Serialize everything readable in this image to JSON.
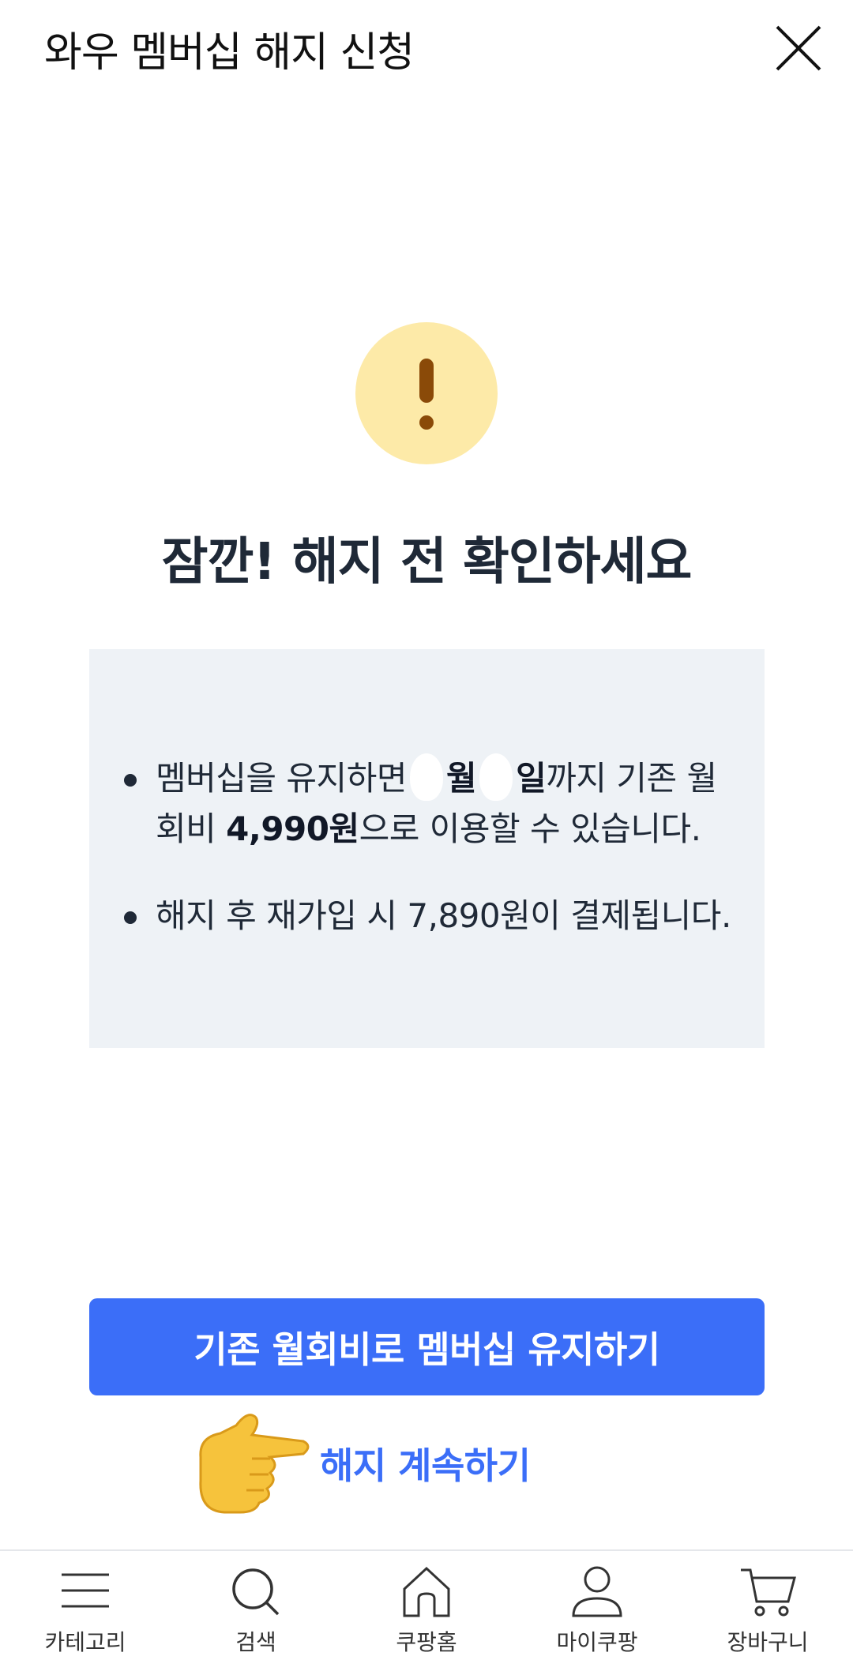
{
  "header": {
    "title": "와우 멤버십 해지 신청"
  },
  "alert": {
    "icon": "exclamation-icon",
    "circle_color": "#fdeaa8",
    "mark_color": "#8a4a08"
  },
  "heading": "잠깐! 해지 전 확인하세요",
  "info": {
    "item1": {
      "part1": "멤버십을 유지하면",
      "month_unit": "월",
      "day_unit": "일",
      "part2": "까지 기존 월회비",
      "price": "4,990원",
      "part3": "으로 이용할 수 있습니다."
    },
    "item2": {
      "text": "해지 후 재가입 시 7,890원이 결제됩니다."
    }
  },
  "actions": {
    "keep_label": "기존 월회비로 멤버십 유지하기",
    "cancel_label": "해지 계속하기",
    "accent_color": "#3b6ef8"
  },
  "nav": {
    "items": [
      {
        "label": "카테고리",
        "icon": "menu-icon"
      },
      {
        "label": "검색",
        "icon": "search-icon"
      },
      {
        "label": "쿠팡홈",
        "icon": "home-icon"
      },
      {
        "label": "마이쿠팡",
        "icon": "user-icon"
      },
      {
        "label": "장바구니",
        "icon": "cart-icon"
      }
    ]
  }
}
